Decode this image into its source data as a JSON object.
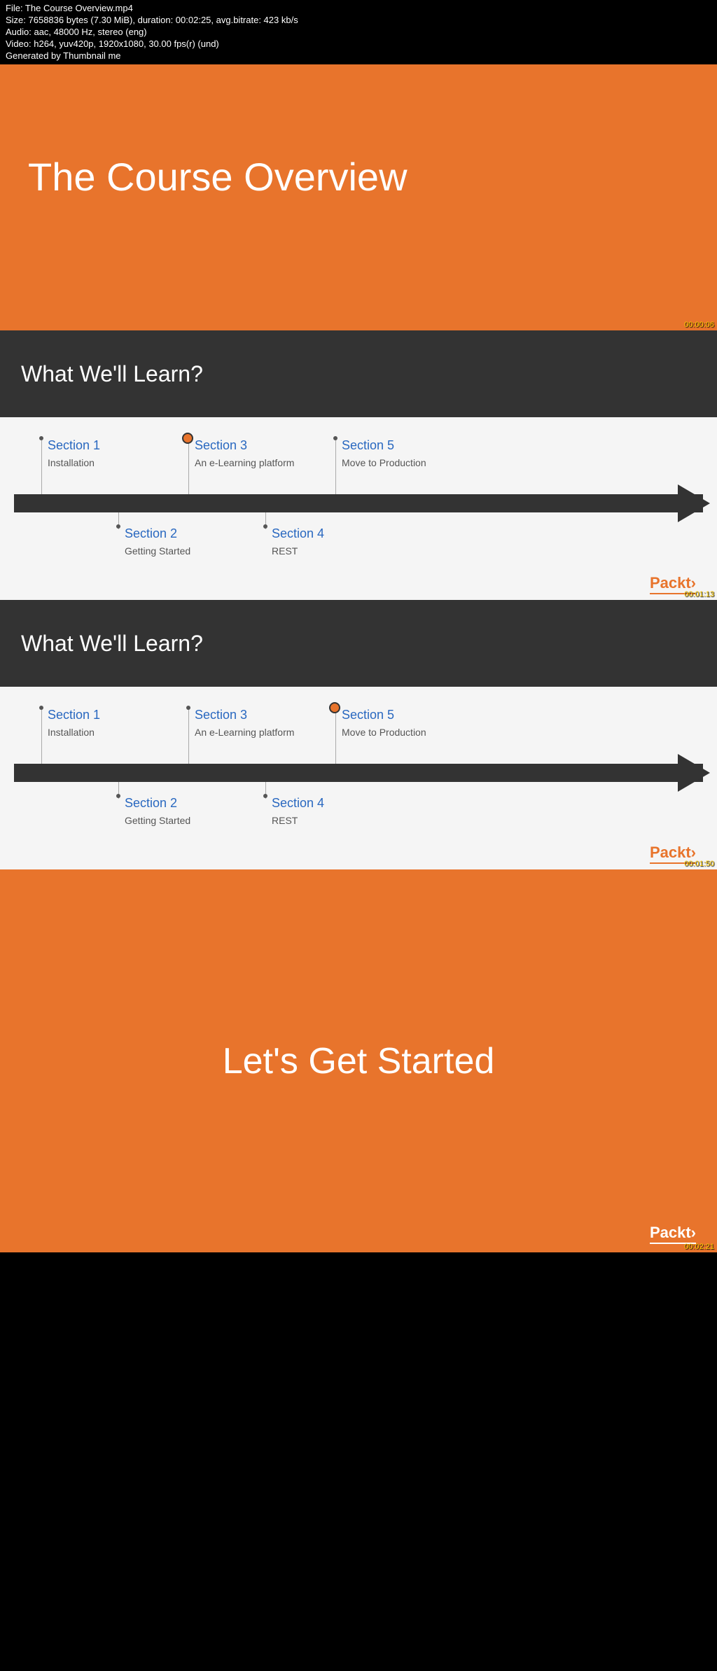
{
  "meta": {
    "file": "File: The Course Overview.mp4",
    "size": "Size: 7658836 bytes (7.30 MiB), duration: 00:02:25, avg.bitrate: 423 kb/s",
    "audio": "Audio: aac, 48000 Hz, stereo (eng)",
    "video": "Video: h264, yuv420p, 1920x1080, 30.00 fps(r) (und)",
    "generated": "Generated by Thumbnail me"
  },
  "slide1": {
    "title": "The Course Overview",
    "timestamp": "00:00:06"
  },
  "slide2": {
    "header": "What We'll Learn?",
    "sections": {
      "s1": {
        "title": "Section 1",
        "desc": "Installation"
      },
      "s2": {
        "title": "Section 2",
        "desc": "Getting Started"
      },
      "s3": {
        "title": "Section 3",
        "desc": "An e-Learning platform"
      },
      "s4": {
        "title": "Section 4",
        "desc": "REST"
      },
      "s5": {
        "title": "Section 5",
        "desc": "Move to Production"
      }
    },
    "highlight": "s3",
    "logo": "Packt›",
    "timestamp": "00:01:13"
  },
  "slide3": {
    "header": "What We'll Learn?",
    "sections": {
      "s1": {
        "title": "Section 1",
        "desc": "Installation"
      },
      "s2": {
        "title": "Section 2",
        "desc": "Getting Started"
      },
      "s3": {
        "title": "Section 3",
        "desc": "An e-Learning platform"
      },
      "s4": {
        "title": "Section 4",
        "desc": "REST"
      },
      "s5": {
        "title": "Section 5",
        "desc": "Move to Production"
      }
    },
    "highlight": "s5",
    "logo": "Packt›",
    "timestamp": "00:01:50"
  },
  "slide4": {
    "title": "Let's Get Started",
    "logo": "Packt›",
    "timestamp": "00:02:21"
  }
}
